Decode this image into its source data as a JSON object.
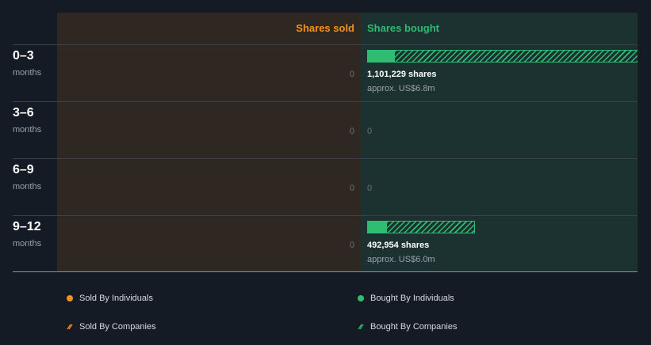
{
  "headers": {
    "sold": "Shares sold",
    "bought": "Shares bought"
  },
  "rows": [
    {
      "period": "0–3",
      "unit": "months",
      "sold": "0",
      "bought_shares": "1,101,229 shares",
      "bought_approx": "approx. US$6.8m",
      "individuals_fraction": 0.1,
      "companies_fraction": 0.9
    },
    {
      "period": "3–6",
      "unit": "months",
      "sold": "0",
      "bought": "0"
    },
    {
      "period": "6–9",
      "unit": "months",
      "sold": "0",
      "bought": "0"
    },
    {
      "period": "9–12",
      "unit": "months",
      "sold": "0",
      "bought_shares": "492,954 shares",
      "bought_approx": "approx. US$6.0m",
      "individuals_fraction": 0.07,
      "companies_fraction": 0.4
    }
  ],
  "legend": {
    "sold_individuals": "Sold By Individuals",
    "sold_companies": "Sold By Companies",
    "bought_individuals": "Bought By Individuals",
    "bought_companies": "Bought By Companies"
  },
  "colors": {
    "sold": "#f5931b",
    "bought": "#2ebd72",
    "sold_bg": "#2f2721",
    "bought_bg": "#1b3230"
  },
  "chart_data": {
    "type": "bar",
    "categories": [
      "0–3 months",
      "3–6 months",
      "6–9 months",
      "9–12 months"
    ],
    "series": [
      {
        "name": "Shares sold",
        "values": [
          0,
          0,
          0,
          0
        ]
      },
      {
        "name": "Shares bought",
        "values": [
          1101229,
          0,
          0,
          492954
        ]
      }
    ],
    "bought_value_labels": [
      "approx. US$6.8m",
      "",
      "",
      "approx. US$6.0m"
    ]
  }
}
